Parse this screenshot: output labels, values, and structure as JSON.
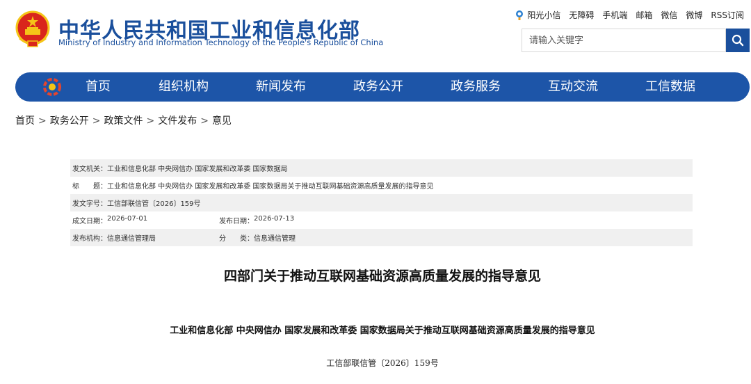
{
  "header": {
    "title": "中华人民共和国工业和信息化部",
    "subtitle": "Ministry of Industry and Information Technology of the People's Republic of China",
    "top_links": [
      "阳光小信",
      "无障碍",
      "手机端",
      "邮箱",
      "微信",
      "微博",
      "RSS订阅"
    ],
    "search_placeholder": "请输入关键字"
  },
  "nav": {
    "items": [
      "首页",
      "组织机构",
      "新闻发布",
      "政务公开",
      "政务服务",
      "互动交流",
      "工信数据"
    ]
  },
  "breadcrumb": [
    "首页",
    "政务公开",
    "政策文件",
    "文件发布",
    "意见"
  ],
  "meta": {
    "issuer_label": "发文机关：",
    "issuer": "工业和信息化部 中央网信办 国家发展和改革委 国家数据局",
    "title_label": "标　　题：",
    "title": "工业和信息化部 中央网信办 国家发展和改革委 国家数据局关于推动互联网基础资源高质量发展的指导意见",
    "docno_label": "发文字号：",
    "docno": "工信部联信管〔2026〕159号",
    "written_label": "成文日期：",
    "written": "2026-07-01",
    "published_label": "发布日期：",
    "published": "2026-07-13",
    "org_label": "发布机构：",
    "org": "信息通信管理局",
    "category_label": "分　　类：",
    "category": "信息通信管理"
  },
  "article": {
    "title": "四部门关于推动互联网基础资源高质量发展的指导意见",
    "subtitle": "工业和信息化部 中央网信办 国家发展和改革委 国家数据局关于推动互联网基础资源高质量发展的指导意见",
    "docno": "工信部联信管〔2026〕159号"
  },
  "colors": {
    "brand_blue": "#1a4f9c",
    "nav_blue": "#1d55a8",
    "emblem_red": "#d9261c",
    "emblem_gold": "#f5c518"
  },
  "icons": [
    "national-emblem-icon",
    "sun-mascot-icon",
    "search-icon",
    "nav-logo-icon"
  ]
}
